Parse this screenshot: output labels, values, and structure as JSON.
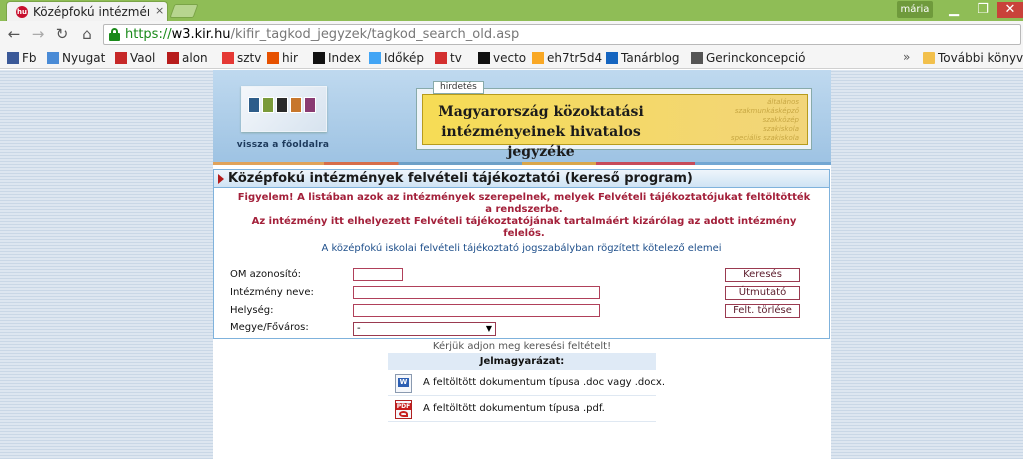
{
  "browser": {
    "tab_title": "Középfokú intézmén",
    "tab_favicon": "hu",
    "tab_close": "×",
    "user": "mária",
    "url_scheme": "https://",
    "url_host": "w3.kir.hu",
    "url_path": "/kifir_tagkod_jegyzek/tagkod_search_old.asp",
    "bookmarks": [
      {
        "label": "Fb",
        "icon": "facebook-icon",
        "color": "#3b5998"
      },
      {
        "label": "Nyugat",
        "icon": "nyugat-icon",
        "color": "#4a8bd6"
      },
      {
        "label": "Vaol",
        "icon": "vaol-icon",
        "color": "#c62828"
      },
      {
        "label": "alon",
        "icon": "alon-icon",
        "color": "#b71c1c"
      },
      {
        "label": "sztv",
        "icon": "sztv-icon",
        "color": "#e53935"
      },
      {
        "label": "hir",
        "icon": "hir-icon",
        "color": "#e65100"
      },
      {
        "label": "Index",
        "icon": "index-icon",
        "color": "#111111"
      },
      {
        "label": "Időkép",
        "icon": "idokep-icon",
        "color": "#42a5f5"
      },
      {
        "label": "tv",
        "icon": "tv-icon",
        "color": "#d32f2f"
      },
      {
        "label": "vecto",
        "icon": "vecto-icon",
        "color": "#111111"
      },
      {
        "label": "eh7tr5d4",
        "icon": "diamond-icon",
        "color": "#f9a825"
      },
      {
        "label": "Tanárblog",
        "icon": "tanarblog-icon",
        "color": "#1565c0"
      },
      {
        "label": "Gerinckoncepció",
        "icon": "g-icon",
        "color": "#555555"
      }
    ],
    "more_chevron": "»",
    "other_bookmarks": "További könyv"
  },
  "banner": {
    "logo_label": "vissza a főoldalra",
    "ad_label": "hirdetés",
    "ad_line1": "Magyarország közoktatási",
    "ad_line2": "intézményeinek hivatalos jegyzéke"
  },
  "panel": {
    "title": "Középfokú intézmények felvételi tájékoztatói (kereső program)",
    "warning_line1": "Figyelem! A listában azok az intézmények szerepelnek, melyek Felvételi tájékoztatójukat feltöltötték a rendszerbe.",
    "warning_line2": "Az intézmény itt elhelyezett Felvételi tájékoztatójának tartalmáért kizárólag az adott intézmény felelős.",
    "legal_link": "A középfokú iskolai felvételi tájékoztató jogszabályban rögzített kötelező elemei"
  },
  "form": {
    "om_label": "OM azonosító:",
    "name_label": "Intézmény neve:",
    "place_label": "Helység:",
    "county_label": "Megye/Főváros:",
    "county_selected": "-",
    "search_btn": "Keresés",
    "guide_btn": "Útmutató",
    "clear_btn": "Felt. törlése"
  },
  "prompt": "Kérjük adjon meg keresési feltételt!",
  "legend": {
    "header": "Jelmagyarázat:",
    "doc_text": "A feltöltött dokumentum típusa .doc vagy .docx.",
    "pdf_text": "A feltöltött dokumentum típusa .pdf."
  }
}
